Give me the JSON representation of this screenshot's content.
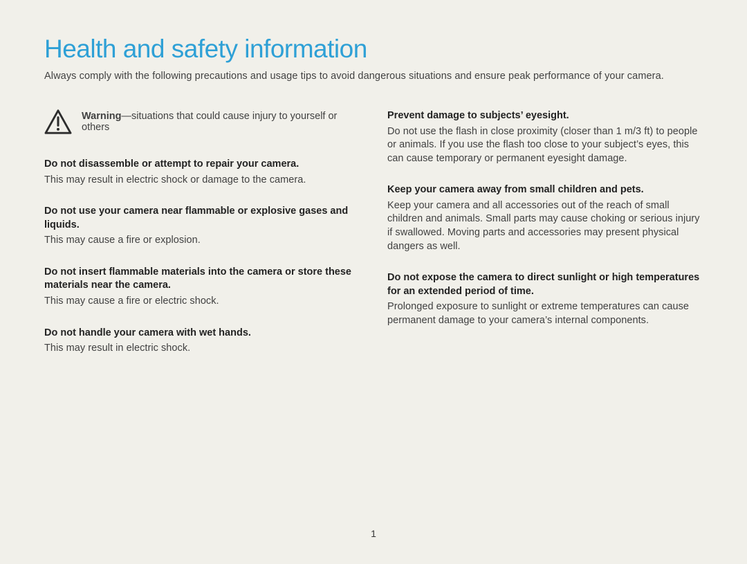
{
  "title": "Health and safety information",
  "intro": "Always comply with the following precautions and usage tips to avoid dangerous situations and ensure peak performance of your camera.",
  "warning": {
    "label": "Warning",
    "desc": "—situations that could cause injury to yourself or others"
  },
  "left": [
    {
      "heading": "Do not disassemble or attempt to repair your camera.",
      "body": "This may result in electric shock or damage to the camera."
    },
    {
      "heading": "Do not use your camera near flammable or explosive gases and liquids.",
      "body": "This may cause a fire or explosion."
    },
    {
      "heading": "Do not insert flammable materials into the camera or store these materials near the camera.",
      "body": "This may cause a fire or electric shock."
    },
    {
      "heading": "Do not handle your camera with wet hands.",
      "body": "This may result in electric shock."
    }
  ],
  "right": [
    {
      "heading": "Prevent damage to subjects’ eyesight.",
      "body": "Do not use the flash in close proximity (closer than 1 m/3 ft) to people or animals. If you use the flash too close to your subject’s eyes, this can cause temporary or permanent eyesight damage."
    },
    {
      "heading": "Keep your camera away from small children and pets.",
      "body": "Keep your camera and all accessories out of the reach of small children and animals. Small parts may cause choking or serious injury if swallowed. Moving parts and accessories may present physical dangers as well."
    },
    {
      "heading": "Do not expose the camera to direct sunlight or high temperatures for an extended period of time.",
      "body": "Prolonged exposure to sunlight or extreme temperatures can cause permanent damage to your camera’s internal components."
    }
  ],
  "pageNumber": "1"
}
